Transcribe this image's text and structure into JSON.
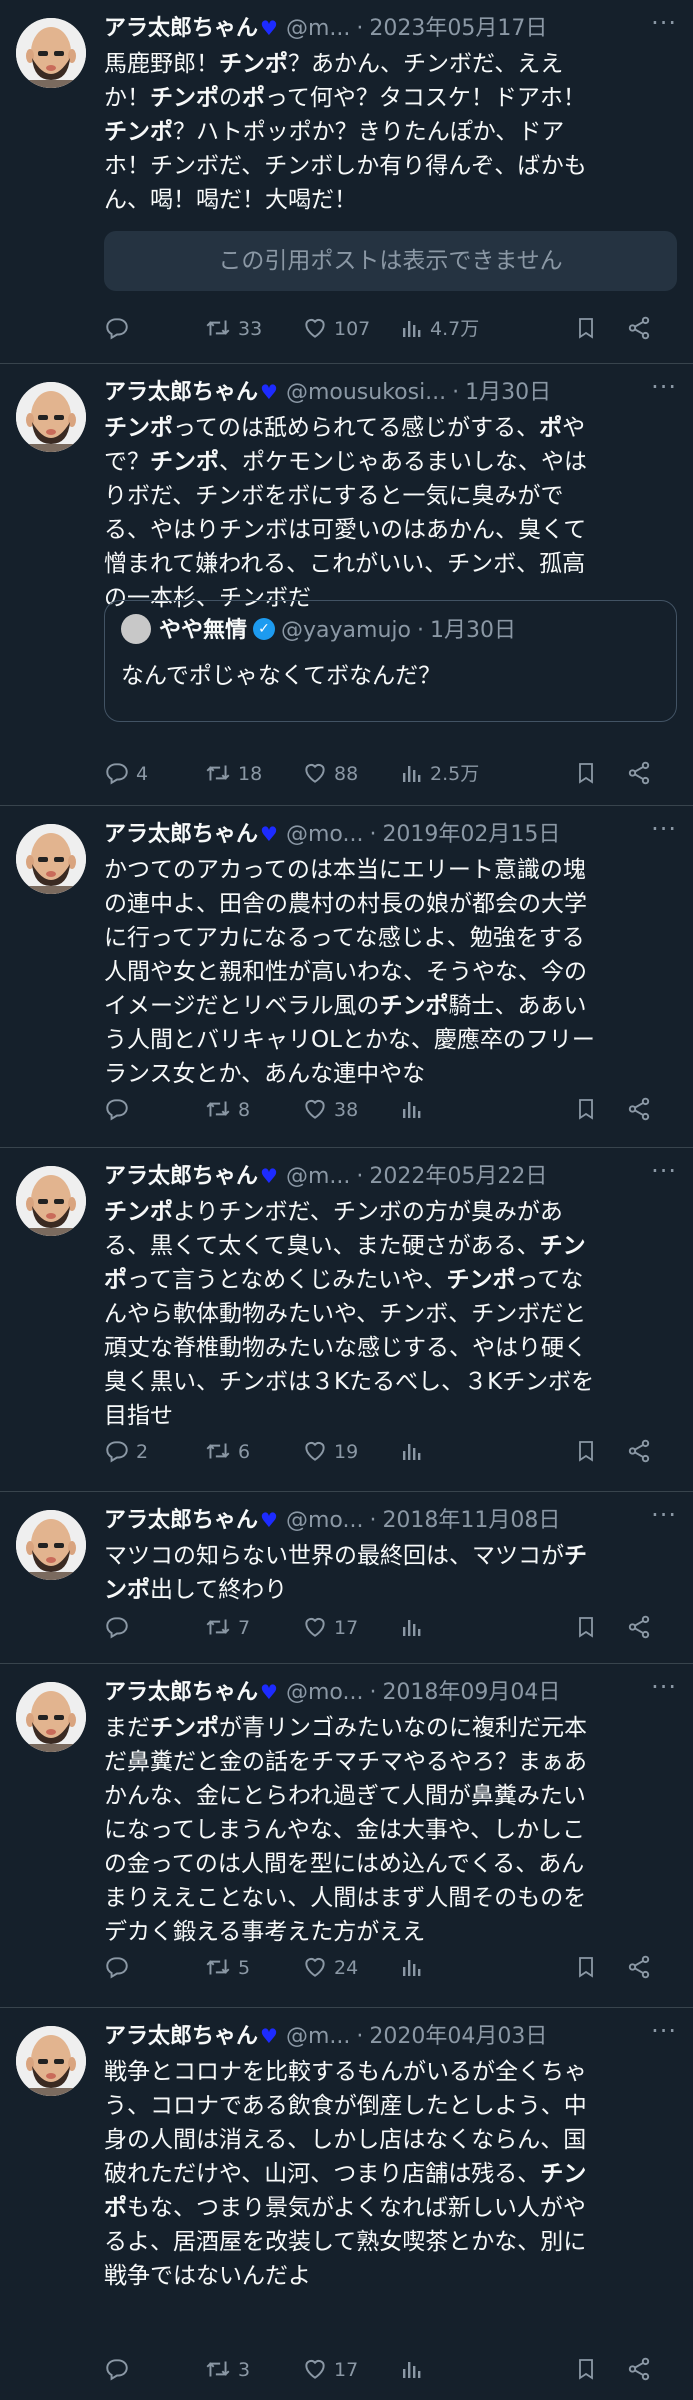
{
  "accent": {
    "heart": "#1d2bff",
    "verified": "#1d9bf0"
  },
  "unavailable_text": "この引用ポストは表示できません",
  "posts": [
    {
      "name": "アラ太郎ちゃん",
      "handle": "@m...",
      "date": "2023年05月17日",
      "body": [
        [
          {
            "t": "馬鹿野郎！"
          },
          {
            "t": "チンポ",
            "b": true
          },
          {
            "t": "？あかん、チンボだ、ええ"
          }
        ],
        [
          {
            "t": "か！"
          },
          {
            "t": "チンポ",
            "b": true
          },
          {
            "t": "の"
          },
          {
            "t": "ポ",
            "b": true
          },
          {
            "t": "って何や？タコスケ！ドアホ！"
          }
        ],
        [
          {
            "t": "チンポ",
            "b": true
          },
          {
            "t": "？ハトポッポか？きりたんぽか、ドア"
          }
        ],
        [
          {
            "t": "ホ！チンボだ、チンボしか有り得んぞ、ばかも"
          }
        ],
        [
          {
            "t": "ん、喝！喝だ！大喝だ！"
          }
        ]
      ],
      "replies": "",
      "reposts": "33",
      "likes": "107",
      "views": "4.7万"
    },
    {
      "name": "アラ太郎ちゃん",
      "handle": "@mousukosi...",
      "date": "1月30日",
      "body": [
        [
          {
            "t": "チンポ",
            "b": true
          },
          {
            "t": "ってのは舐められてる感じがする、"
          },
          {
            "t": "ポ",
            "b": true
          },
          {
            "t": "や"
          }
        ],
        [
          {
            "t": "で？"
          },
          {
            "t": "チンポ",
            "b": true
          },
          {
            "t": "、ポケモンじゃあるまいしな、やは"
          }
        ],
        [
          {
            "t": "りボだ、チンボをボにすると一気に臭みがで"
          }
        ],
        [
          {
            "t": "る、やはりチンボは可愛いのはあかん、臭くて"
          }
        ],
        [
          {
            "t": "憎まれて嫌われる、これがいい、チンボ、孤高"
          }
        ],
        [
          {
            "t": "の一本杉、チンボだ"
          }
        ]
      ],
      "quote": {
        "name": "やや無情",
        "handle": "@yayamujo",
        "date": "1月30日",
        "text": "なんでポじゃなくてボなんだ？"
      },
      "replies": "4",
      "reposts": "18",
      "likes": "88",
      "views": "2.5万"
    },
    {
      "name": "アラ太郎ちゃん",
      "handle": "@mo...",
      "date": "2019年02月15日",
      "body": [
        [
          {
            "t": "かつてのアカってのは本当にエリート意識の塊"
          }
        ],
        [
          {
            "t": "の連中よ、田舎の農村の村長の娘が都会の大学"
          }
        ],
        [
          {
            "t": "に行ってアカになるってな感じよ、勉強をする"
          }
        ],
        [
          {
            "t": "人間や女と親和性が高いわな、そうやな、今の"
          }
        ],
        [
          {
            "t": "イメージだとリベラル風の"
          },
          {
            "t": "チンポ",
            "b": true
          },
          {
            "t": "騎士、ああい"
          }
        ],
        [
          {
            "t": "う人間とバリキャリOLとかな、慶應卒のフリー"
          }
        ],
        [
          {
            "t": "ランス女とか、あんな連中やな"
          }
        ]
      ],
      "replies": "",
      "reposts": "8",
      "likes": "38",
      "views": ""
    },
    {
      "name": "アラ太郎ちゃん",
      "handle": "@m...",
      "date": "2022年05月22日",
      "body": [
        [
          {
            "t": "チンポ",
            "b": true
          },
          {
            "t": "よりチンボだ、チンボの方が臭みがあ"
          }
        ],
        [
          {
            "t": "る、黒くて太くて臭い、また硬さがある、"
          },
          {
            "t": "チン",
            "b": true
          }
        ],
        [
          {
            "t": "ポ",
            "b": true
          },
          {
            "t": "って言うとなめくじみたいや、"
          },
          {
            "t": "チンポ",
            "b": true
          },
          {
            "t": "ってな"
          }
        ],
        [
          {
            "t": "んやら軟体動物みたいや、チンボ、チンボだと"
          }
        ],
        [
          {
            "t": "頑丈な脊椎動物みたいな感じする、やはり硬く"
          }
        ],
        [
          {
            "t": "臭く黒い、チンボは３Kたるべし、３Kチンボを"
          }
        ],
        [
          {
            "t": "目指せ"
          }
        ]
      ],
      "replies": "2",
      "reposts": "6",
      "likes": "19",
      "views": ""
    },
    {
      "name": "アラ太郎ちゃん",
      "handle": "@mo...",
      "date": "2018年11月08日",
      "body": [
        [
          {
            "t": "マツコの知らない世界の最終回は、マツコが"
          },
          {
            "t": "チ",
            "b": true
          }
        ],
        [
          {
            "t": "ンポ",
            "b": true
          },
          {
            "t": "出して終わり"
          }
        ]
      ],
      "replies": "",
      "reposts": "7",
      "likes": "17",
      "views": ""
    },
    {
      "name": "アラ太郎ちゃん",
      "handle": "@mo...",
      "date": "2018年09月04日",
      "body": [
        [
          {
            "t": "まだ"
          },
          {
            "t": "チンポ",
            "b": true
          },
          {
            "t": "が青リンゴみたいなのに複利だ元本"
          }
        ],
        [
          {
            "t": "だ鼻糞だと金の話をチマチマやるやろ？まぁあ"
          }
        ],
        [
          {
            "t": "かんな、金にとらわれ過ぎて人間が鼻糞みたい"
          }
        ],
        [
          {
            "t": "になってしまうんやな、金は大事や、しかしこ"
          }
        ],
        [
          {
            "t": "の金ってのは人間を型にはめ込んでくる、あん"
          }
        ],
        [
          {
            "t": "まりええことない、人間はまず人間そのものを"
          }
        ],
        [
          {
            "t": "デカく鍛える事考えた方がええ"
          }
        ]
      ],
      "replies": "",
      "reposts": "5",
      "likes": "24",
      "views": ""
    },
    {
      "name": "アラ太郎ちゃん",
      "handle": "@m...",
      "date": "2020年04月03日",
      "body": [
        [
          {
            "t": "戦争とコロナを比較するもんがいるが全くちゃ"
          }
        ],
        [
          {
            "t": "う、コロナである飲食が倒産したとしよう、中"
          }
        ],
        [
          {
            "t": "身の人間は消える、しかし店はなくならん、国"
          }
        ],
        [
          {
            "t": "破れただけや、山河、つまり店舗は残る、"
          },
          {
            "t": "チン",
            "b": true
          }
        ],
        [
          {
            "t": "ポ",
            "b": true
          },
          {
            "t": "もな、つまり景気がよくなれば新しい人がや"
          }
        ],
        [
          {
            "t": "るよ、居酒屋を改装して熟女喫茶とかな、別に"
          }
        ],
        [
          {
            "t": "戦争ではないんだよ"
          }
        ]
      ],
      "replies": "",
      "reposts": "3",
      "likes": "17",
      "views": ""
    }
  ]
}
